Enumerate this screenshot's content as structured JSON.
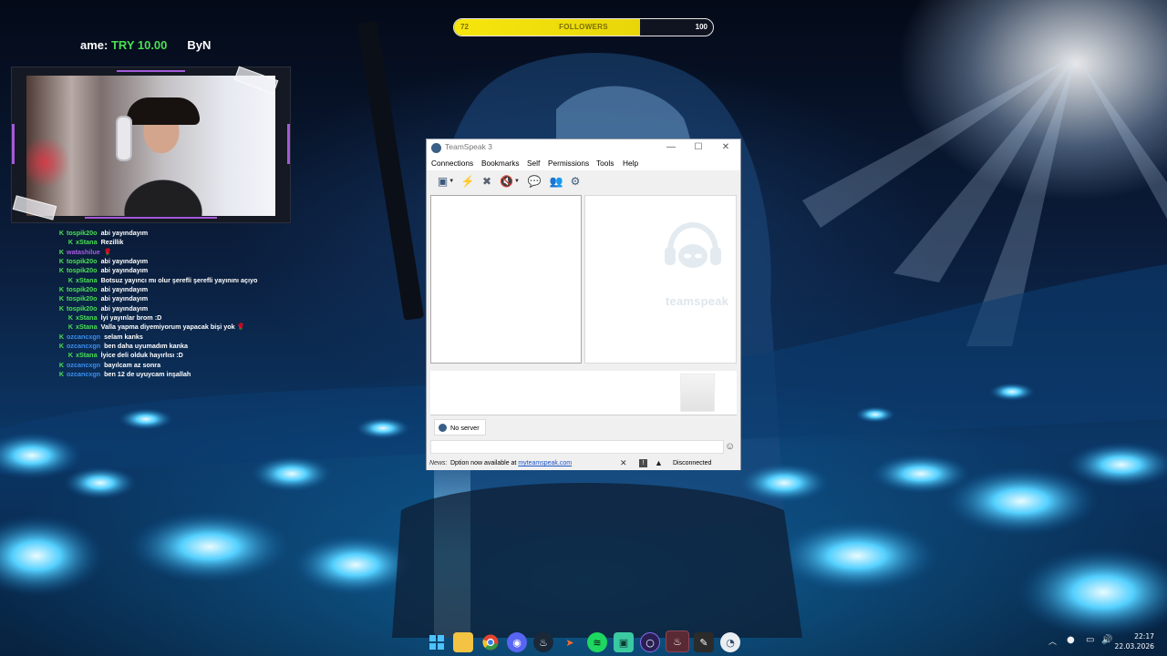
{
  "follower_goal": {
    "current": "72",
    "label": "FOLLOWERS",
    "target": "100",
    "progress_fraction": 0.72
  },
  "ticker": {
    "prefix": "ame: ",
    "amount": "TRY 10.00",
    "suffix": "ByN"
  },
  "chat": [
    {
      "kick": true,
      "user": "tospik20o",
      "user_color": "#49e052",
      "msg": "abi yayındayım"
    },
    {
      "kick": true,
      "user": "xStana",
      "user_color": "#49e052",
      "msg": "Rezillik",
      "indent": true
    },
    {
      "kick": true,
      "user": "watashilue",
      "user_color": "#a65be0",
      "msg": "🌹"
    },
    {
      "kick": true,
      "user": "tospik20o",
      "user_color": "#49e052",
      "msg": "abi yayındayım"
    },
    {
      "kick": true,
      "user": "tospik20o",
      "user_color": "#49e052",
      "msg": "abi yayındayım"
    },
    {
      "kick": true,
      "user": "xStana",
      "user_color": "#49e052",
      "msg": "Botsuz yayıncı mı olur şerefli şerefli yayınını açıyo",
      "indent": true
    },
    {
      "kick": true,
      "user": "tospik20o",
      "user_color": "#49e052",
      "msg": "abi yayındayım"
    },
    {
      "kick": true,
      "user": "tospik20o",
      "user_color": "#49e052",
      "msg": "abi yayındayım"
    },
    {
      "kick": true,
      "user": "tospik20o",
      "user_color": "#49e052",
      "msg": "abi yayındayım"
    },
    {
      "kick": true,
      "user": "xStana",
      "user_color": "#49e052",
      "msg": "İyi yayınlar brom :D",
      "indent": true
    },
    {
      "kick": true,
      "user": "xStana",
      "user_color": "#49e052",
      "msg": "Valla yapma diyemiyorum yapacak bişi yok 🌹",
      "indent": true
    },
    {
      "kick": true,
      "user": "ozcancxgn",
      "user_color": "#3a8ff0",
      "msg": "selam kanks"
    },
    {
      "kick": true,
      "user": "ozcancxgn",
      "user_color": "#3a8ff0",
      "msg": "ben daha uyumadım kanka"
    },
    {
      "kick": true,
      "user": "xStana",
      "user_color": "#49e052",
      "msg": "İyice deli olduk hayırlısı :D",
      "indent": true
    },
    {
      "kick": true,
      "user": "ozcancxgn",
      "user_color": "#3a8ff0",
      "msg": "bayılcam az sonra"
    },
    {
      "kick": true,
      "user": "ozcancxgn",
      "user_color": "#3a8ff0",
      "msg": "ben 12 de uyuycam inşallah"
    }
  ],
  "teamspeak": {
    "title": "TeamSpeak 3",
    "menu": [
      "Connections",
      "Bookmarks",
      "Self",
      "Permissions",
      "Tools",
      "Help"
    ],
    "toolbar_icons": [
      "connect-icon",
      "disconnect-icon",
      "away-icon",
      "mute-icon",
      "chat-icon",
      "contacts-icon",
      "hotkey-icon"
    ],
    "logo_text": "teamspeak",
    "server_tab": "No server",
    "news_label": "News:",
    "news_text": "Dption now available at ",
    "news_link": "myteamspeak.com",
    "status": "Disconnected"
  },
  "taskbar": {
    "apps": [
      "windows-start",
      "file-explorer",
      "chrome",
      "discord",
      "steam",
      "arrow-app",
      "spotify",
      "game-app",
      "browser-app",
      "steam-active",
      "pen-app",
      "teamspeak"
    ],
    "time": "22:17",
    "date": "22.03.2026"
  }
}
